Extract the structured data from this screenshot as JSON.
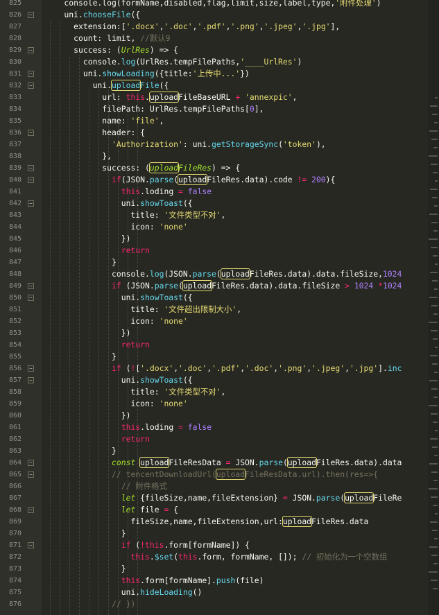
{
  "editor": {
    "lines": [
      {
        "n": "825",
        "fold": false,
        "t": [
          [
            "    console.",
            ""
          ],
          [
            "log",
            ""
          ],
          [
            "(formName,disabled,flag,limit,size,label,type,",
            ""
          ],
          [
            "'附件处理'",
            "str"
          ],
          [
            ")",
            ""
          ]
        ]
      },
      {
        "n": "826",
        "fold": true,
        "t": [
          [
            "    uni.",
            ""
          ],
          [
            "chooseFile",
            "fn"
          ],
          [
            "({",
            ""
          ]
        ]
      },
      {
        "n": "827",
        "fold": false,
        "t": [
          [
            "      extension:[",
            ""
          ],
          [
            "'.docx'",
            "str"
          ],
          [
            ",",
            ""
          ],
          [
            "'.doc'",
            "str"
          ],
          [
            ",",
            ""
          ],
          [
            "'.pdf'",
            "str"
          ],
          [
            ",",
            ""
          ],
          [
            "'.png'",
            "str"
          ],
          [
            ",",
            ""
          ],
          [
            "'.jpeg'",
            "str"
          ],
          [
            ",",
            ""
          ],
          [
            "'.jpg'",
            "str"
          ],
          [
            "],",
            ""
          ]
        ]
      },
      {
        "n": "828",
        "fold": false,
        "t": [
          [
            "      count: limit, ",
            ""
          ],
          [
            "//默认9",
            "cm"
          ]
        ]
      },
      {
        "n": "829",
        "fold": true,
        "t": [
          [
            "      success: (",
            ""
          ],
          [
            "UrlRes",
            "it"
          ],
          [
            ") => {",
            ""
          ]
        ]
      },
      {
        "n": "830",
        "fold": false,
        "t": [
          [
            "        console.",
            ""
          ],
          [
            "log",
            "fn"
          ],
          [
            "(UrlRes.tempFilePaths,",
            ""
          ],
          [
            "'____UrlRes'",
            "str"
          ],
          [
            ")",
            ""
          ]
        ]
      },
      {
        "n": "831",
        "fold": true,
        "t": [
          [
            "        uni.",
            ""
          ],
          [
            "showLoading",
            "fn"
          ],
          [
            "({title:",
            ""
          ],
          [
            "'上传中...'",
            "str"
          ],
          [
            "})",
            ""
          ]
        ]
      },
      {
        "n": "832",
        "fold": true,
        "t": [
          [
            "          uni.",
            ""
          ],
          [
            "uploadFile",
            "fn"
          ],
          [
            "({",
            ""
          ]
        ]
      },
      {
        "n": "833",
        "fold": false,
        "t": [
          [
            "            url: ",
            ""
          ],
          [
            "this",
            "kw"
          ],
          [
            ".uploadFileBaseURL ",
            ""
          ],
          [
            "+",
            "kw"
          ],
          [
            " ",
            ""
          ],
          [
            "'annexpic'",
            "str"
          ],
          [
            ",",
            ""
          ]
        ]
      },
      {
        "n": "834",
        "fold": false,
        "t": [
          [
            "            filePath: UrlRes.tempFilePaths[",
            ""
          ],
          [
            "0",
            "num"
          ],
          [
            "],",
            ""
          ]
        ]
      },
      {
        "n": "835",
        "fold": false,
        "t": [
          [
            "            name: ",
            ""
          ],
          [
            "'file'",
            "str"
          ],
          [
            ",",
            ""
          ]
        ]
      },
      {
        "n": "836",
        "fold": true,
        "t": [
          [
            "            header: {",
            ""
          ]
        ]
      },
      {
        "n": "837",
        "fold": false,
        "t": [
          [
            "              ",
            ""
          ],
          [
            "'Authorization'",
            "str"
          ],
          [
            ": uni.",
            ""
          ],
          [
            "getStorageSync",
            "fn"
          ],
          [
            "(",
            ""
          ],
          [
            "'token'",
            "str"
          ],
          [
            "),",
            ""
          ]
        ]
      },
      {
        "n": "838",
        "fold": false,
        "t": [
          [
            "            },",
            ""
          ]
        ]
      },
      {
        "n": "839",
        "fold": true,
        "t": [
          [
            "            success: (",
            ""
          ],
          [
            "uploadFileRes",
            "it"
          ],
          [
            ") => {",
            ""
          ]
        ]
      },
      {
        "n": "840",
        "fold": true,
        "t": [
          [
            "              ",
            ""
          ],
          [
            "if",
            "kw"
          ],
          [
            "(JSON.",
            ""
          ],
          [
            "parse",
            "fn"
          ],
          [
            "(uploadFileRes.data).code ",
            ""
          ],
          [
            "!=",
            "kw"
          ],
          [
            " ",
            ""
          ],
          [
            "200",
            "num"
          ],
          [
            "){",
            ""
          ]
        ]
      },
      {
        "n": "841",
        "fold": false,
        "t": [
          [
            "                ",
            ""
          ],
          [
            "this",
            "kw"
          ],
          [
            ".loding ",
            ""
          ],
          [
            "=",
            "kw"
          ],
          [
            " ",
            ""
          ],
          [
            "false",
            "num"
          ]
        ]
      },
      {
        "n": "842",
        "fold": true,
        "t": [
          [
            "                uni.",
            ""
          ],
          [
            "showToast",
            "fn"
          ],
          [
            "({",
            ""
          ]
        ]
      },
      {
        "n": "843",
        "fold": false,
        "t": [
          [
            "                  title: ",
            ""
          ],
          [
            "'文件类型不对'",
            "str"
          ],
          [
            ",",
            ""
          ]
        ]
      },
      {
        "n": "844",
        "fold": false,
        "t": [
          [
            "                  icon: ",
            ""
          ],
          [
            "'none'",
            "str"
          ]
        ]
      },
      {
        "n": "845",
        "fold": false,
        "t": [
          [
            "                })",
            ""
          ]
        ]
      },
      {
        "n": "846",
        "fold": false,
        "t": [
          [
            "                ",
            ""
          ],
          [
            "return",
            "kw"
          ]
        ]
      },
      {
        "n": "847",
        "fold": false,
        "t": [
          [
            "              }",
            ""
          ]
        ]
      },
      {
        "n": "848",
        "fold": false,
        "t": [
          [
            "              console.",
            ""
          ],
          [
            "log",
            "fn"
          ],
          [
            "(JSON.",
            ""
          ],
          [
            "parse",
            "fn"
          ],
          [
            "(uploadFileRes.data).data.fileSize,",
            ""
          ],
          [
            "1024",
            "num"
          ]
        ]
      },
      {
        "n": "849",
        "fold": true,
        "t": [
          [
            "              ",
            ""
          ],
          [
            "if",
            "kw"
          ],
          [
            " (JSON.",
            ""
          ],
          [
            "parse",
            "fn"
          ],
          [
            "(uploadFileRes.data).data.fileSize ",
            ""
          ],
          [
            ">",
            "kw"
          ],
          [
            " ",
            ""
          ],
          [
            "1024",
            "num"
          ],
          [
            " ",
            ""
          ],
          [
            "*",
            "kw"
          ],
          [
            "1024",
            "num"
          ]
        ]
      },
      {
        "n": "850",
        "fold": true,
        "t": [
          [
            "                uni.",
            ""
          ],
          [
            "showToast",
            "fn"
          ],
          [
            "({",
            ""
          ]
        ]
      },
      {
        "n": "851",
        "fold": false,
        "t": [
          [
            "                  title: ",
            ""
          ],
          [
            "'文件超出限制大小'",
            "str"
          ],
          [
            ",",
            ""
          ]
        ]
      },
      {
        "n": "852",
        "fold": false,
        "t": [
          [
            "                  icon: ",
            ""
          ],
          [
            "'none'",
            "str"
          ]
        ]
      },
      {
        "n": "853",
        "fold": false,
        "t": [
          [
            "                })",
            ""
          ]
        ]
      },
      {
        "n": "854",
        "fold": false,
        "t": [
          [
            "                ",
            ""
          ],
          [
            "return",
            "kw"
          ]
        ]
      },
      {
        "n": "855",
        "fold": false,
        "t": [
          [
            "              }",
            ""
          ]
        ]
      },
      {
        "n": "856",
        "fold": true,
        "t": [
          [
            "              ",
            ""
          ],
          [
            "if",
            "kw"
          ],
          [
            " (",
            ""
          ],
          [
            "!",
            "kw"
          ],
          [
            "[",
            ""
          ],
          [
            "'.docx'",
            "str"
          ],
          [
            ",",
            ""
          ],
          [
            "'.doc'",
            "str"
          ],
          [
            ",",
            ""
          ],
          [
            "'.pdf'",
            "str"
          ],
          [
            ",",
            ""
          ],
          [
            "'.doc'",
            "str"
          ],
          [
            ",",
            ""
          ],
          [
            "'.png'",
            "str"
          ],
          [
            ",",
            ""
          ],
          [
            "'.jpeg'",
            "str"
          ],
          [
            ",",
            ""
          ],
          [
            "'.jpg'",
            "str"
          ],
          [
            "].",
            ""
          ],
          [
            "inc",
            "fn"
          ]
        ]
      },
      {
        "n": "857",
        "fold": true,
        "t": [
          [
            "                uni.",
            ""
          ],
          [
            "showToast",
            "fn"
          ],
          [
            "({",
            ""
          ]
        ]
      },
      {
        "n": "858",
        "fold": false,
        "t": [
          [
            "                  title: ",
            ""
          ],
          [
            "'文件类型不对'",
            "str"
          ],
          [
            ",",
            ""
          ]
        ]
      },
      {
        "n": "859",
        "fold": false,
        "t": [
          [
            "                  icon: ",
            ""
          ],
          [
            "'none'",
            "str"
          ]
        ]
      },
      {
        "n": "860",
        "fold": false,
        "t": [
          [
            "                })",
            ""
          ]
        ]
      },
      {
        "n": "861",
        "fold": false,
        "t": [
          [
            "                ",
            ""
          ],
          [
            "this",
            "kw"
          ],
          [
            ".loding ",
            ""
          ],
          [
            "=",
            "kw"
          ],
          [
            " ",
            ""
          ],
          [
            "false",
            "num"
          ]
        ]
      },
      {
        "n": "862",
        "fold": false,
        "t": [
          [
            "                ",
            ""
          ],
          [
            "return",
            "kw"
          ]
        ]
      },
      {
        "n": "863",
        "fold": false,
        "t": [
          [
            "              }",
            ""
          ]
        ]
      },
      {
        "n": "864",
        "fold": true,
        "t": [
          [
            "              ",
            ""
          ],
          [
            "const",
            "it"
          ],
          [
            " uploadFileResData ",
            ""
          ],
          [
            "=",
            "kw"
          ],
          [
            " JSON.",
            ""
          ],
          [
            "parse",
            "fn"
          ],
          [
            "(uploadFileRes.data).data",
            ""
          ]
        ]
      },
      {
        "n": "865",
        "fold": true,
        "t": [
          [
            "              ",
            ""
          ],
          [
            "// tencentDownloadUrl(uploadFileResData.url).then(res=>{",
            "cm"
          ]
        ]
      },
      {
        "n": "866",
        "fold": false,
        "t": [
          [
            "                ",
            ""
          ],
          [
            "// 附件格式",
            "cm"
          ]
        ]
      },
      {
        "n": "867",
        "fold": false,
        "t": [
          [
            "                ",
            ""
          ],
          [
            "let",
            "it"
          ],
          [
            " {fileSize,name,fileExtension} ",
            ""
          ],
          [
            "=",
            "kw"
          ],
          [
            " JSON.",
            ""
          ],
          [
            "parse",
            "fn"
          ],
          [
            "(uploadFileRe",
            ""
          ]
        ]
      },
      {
        "n": "868",
        "fold": true,
        "t": [
          [
            "                ",
            ""
          ],
          [
            "let",
            "it"
          ],
          [
            " file ",
            ""
          ],
          [
            "=",
            "kw"
          ],
          [
            " {",
            ""
          ]
        ]
      },
      {
        "n": "869",
        "fold": false,
        "t": [
          [
            "                  fileSize,name,fileExtension,url:uploadFileRes.data",
            ""
          ]
        ]
      },
      {
        "n": "870",
        "fold": false,
        "t": [
          [
            "                }",
            ""
          ]
        ]
      },
      {
        "n": "871",
        "fold": true,
        "t": [
          [
            "                ",
            ""
          ],
          [
            "if",
            "kw"
          ],
          [
            " (",
            ""
          ],
          [
            "!",
            "kw"
          ],
          [
            "this",
            "kw"
          ],
          [
            ".form[formName]) {",
            ""
          ]
        ]
      },
      {
        "n": "872",
        "fold": false,
        "t": [
          [
            "                  ",
            ""
          ],
          [
            "this",
            "kw"
          ],
          [
            ".",
            ""
          ],
          [
            "$set",
            "fn"
          ],
          [
            "(",
            ""
          ],
          [
            "this",
            "kw"
          ],
          [
            ".form, formName, []); ",
            ""
          ],
          [
            "// 初始化为一个空数组",
            "cm"
          ]
        ]
      },
      {
        "n": "873",
        "fold": false,
        "t": [
          [
            "                }",
            ""
          ]
        ]
      },
      {
        "n": "874",
        "fold": false,
        "t": [
          [
            "                ",
            ""
          ],
          [
            "this",
            "kw"
          ],
          [
            ".form[formName].",
            ""
          ],
          [
            "push",
            "fn"
          ],
          [
            "(file)",
            ""
          ]
        ]
      },
      {
        "n": "875",
        "fold": false,
        "t": [
          [
            "                uni.",
            ""
          ],
          [
            "hideLoading",
            "fn"
          ],
          [
            "()",
            ""
          ]
        ]
      },
      {
        "n": "876",
        "fold": false,
        "t": [
          [
            "              ",
            ""
          ],
          [
            "// })",
            "cm"
          ]
        ]
      }
    ]
  },
  "colors": {
    "background": "#272822",
    "keyword": "#f92672",
    "function": "#66d9ef",
    "string": "#e6db74",
    "number": "#ae81ff",
    "comment": "#75715e",
    "italic_keyword": "#a6e22e",
    "highlight_box": "#e6db74"
  },
  "highlight_word": "upload"
}
